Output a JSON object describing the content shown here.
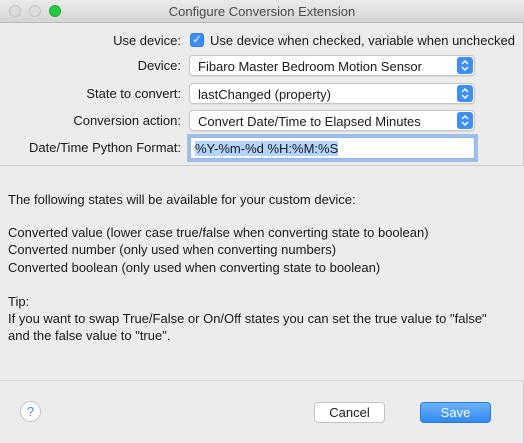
{
  "window": {
    "title": "Configure Conversion Extension"
  },
  "form": {
    "use_device": {
      "label": "Use device:",
      "checkbox_text": "Use device when checked, variable when unchecked",
      "checked": true
    },
    "device": {
      "label": "Device:",
      "value": "Fibaro Master Bedroom Motion Sensor"
    },
    "state": {
      "label": "State to convert:",
      "value": "lastChanged (property)"
    },
    "action": {
      "label": "Conversion action:",
      "value": "Convert Date/Time to Elapsed Minutes"
    },
    "format": {
      "label": "Date/Time Python Format:",
      "value": "%Y-%m-%d %H:%M:%S"
    }
  },
  "info": {
    "intro": "The following states will be available for your custom device:",
    "line1": "Converted value (lower case true/false when converting state to boolean)",
    "line2": "Converted number (only used when converting numbers)",
    "line3": "Converted boolean (only used when converting state to boolean)",
    "tip_heading": "Tip:",
    "tip1": "If you want to swap True/False or On/Off states you can set the true value to \"false\"",
    "tip2": "and the false value to \"true\"."
  },
  "footer": {
    "help_glyph": "?",
    "cancel_label": "Cancel",
    "save_label": "Save"
  },
  "colors": {
    "accent": "#3d8ef5",
    "window_bg": "#ececec"
  },
  "icons": {
    "checkbox": "checkmark-icon",
    "popup": "chevron-up-down-icon",
    "help": "question-mark-icon"
  }
}
